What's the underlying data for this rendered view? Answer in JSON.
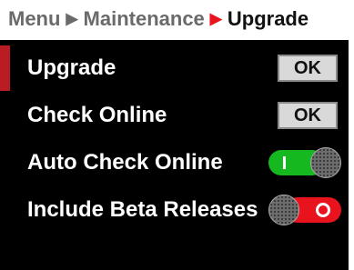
{
  "breadcrumb": {
    "items": [
      "Menu",
      "Maintenance",
      "Upgrade"
    ],
    "separator": ">"
  },
  "colors": {
    "accent_red": "#e8131d",
    "selected_bar": "#b91c22",
    "toggle_on": "#16b81f",
    "toggle_off": "#e8131d"
  },
  "rows": [
    {
      "label": "Upgrade",
      "control": "button",
      "button_label": "OK",
      "selected": true
    },
    {
      "label": "Check Online",
      "control": "button",
      "button_label": "OK",
      "selected": false
    },
    {
      "label": "Auto Check Online",
      "control": "toggle",
      "state": "on",
      "selected": false
    },
    {
      "label": "Include Beta Releases",
      "control": "toggle",
      "state": "off",
      "selected": false
    }
  ]
}
